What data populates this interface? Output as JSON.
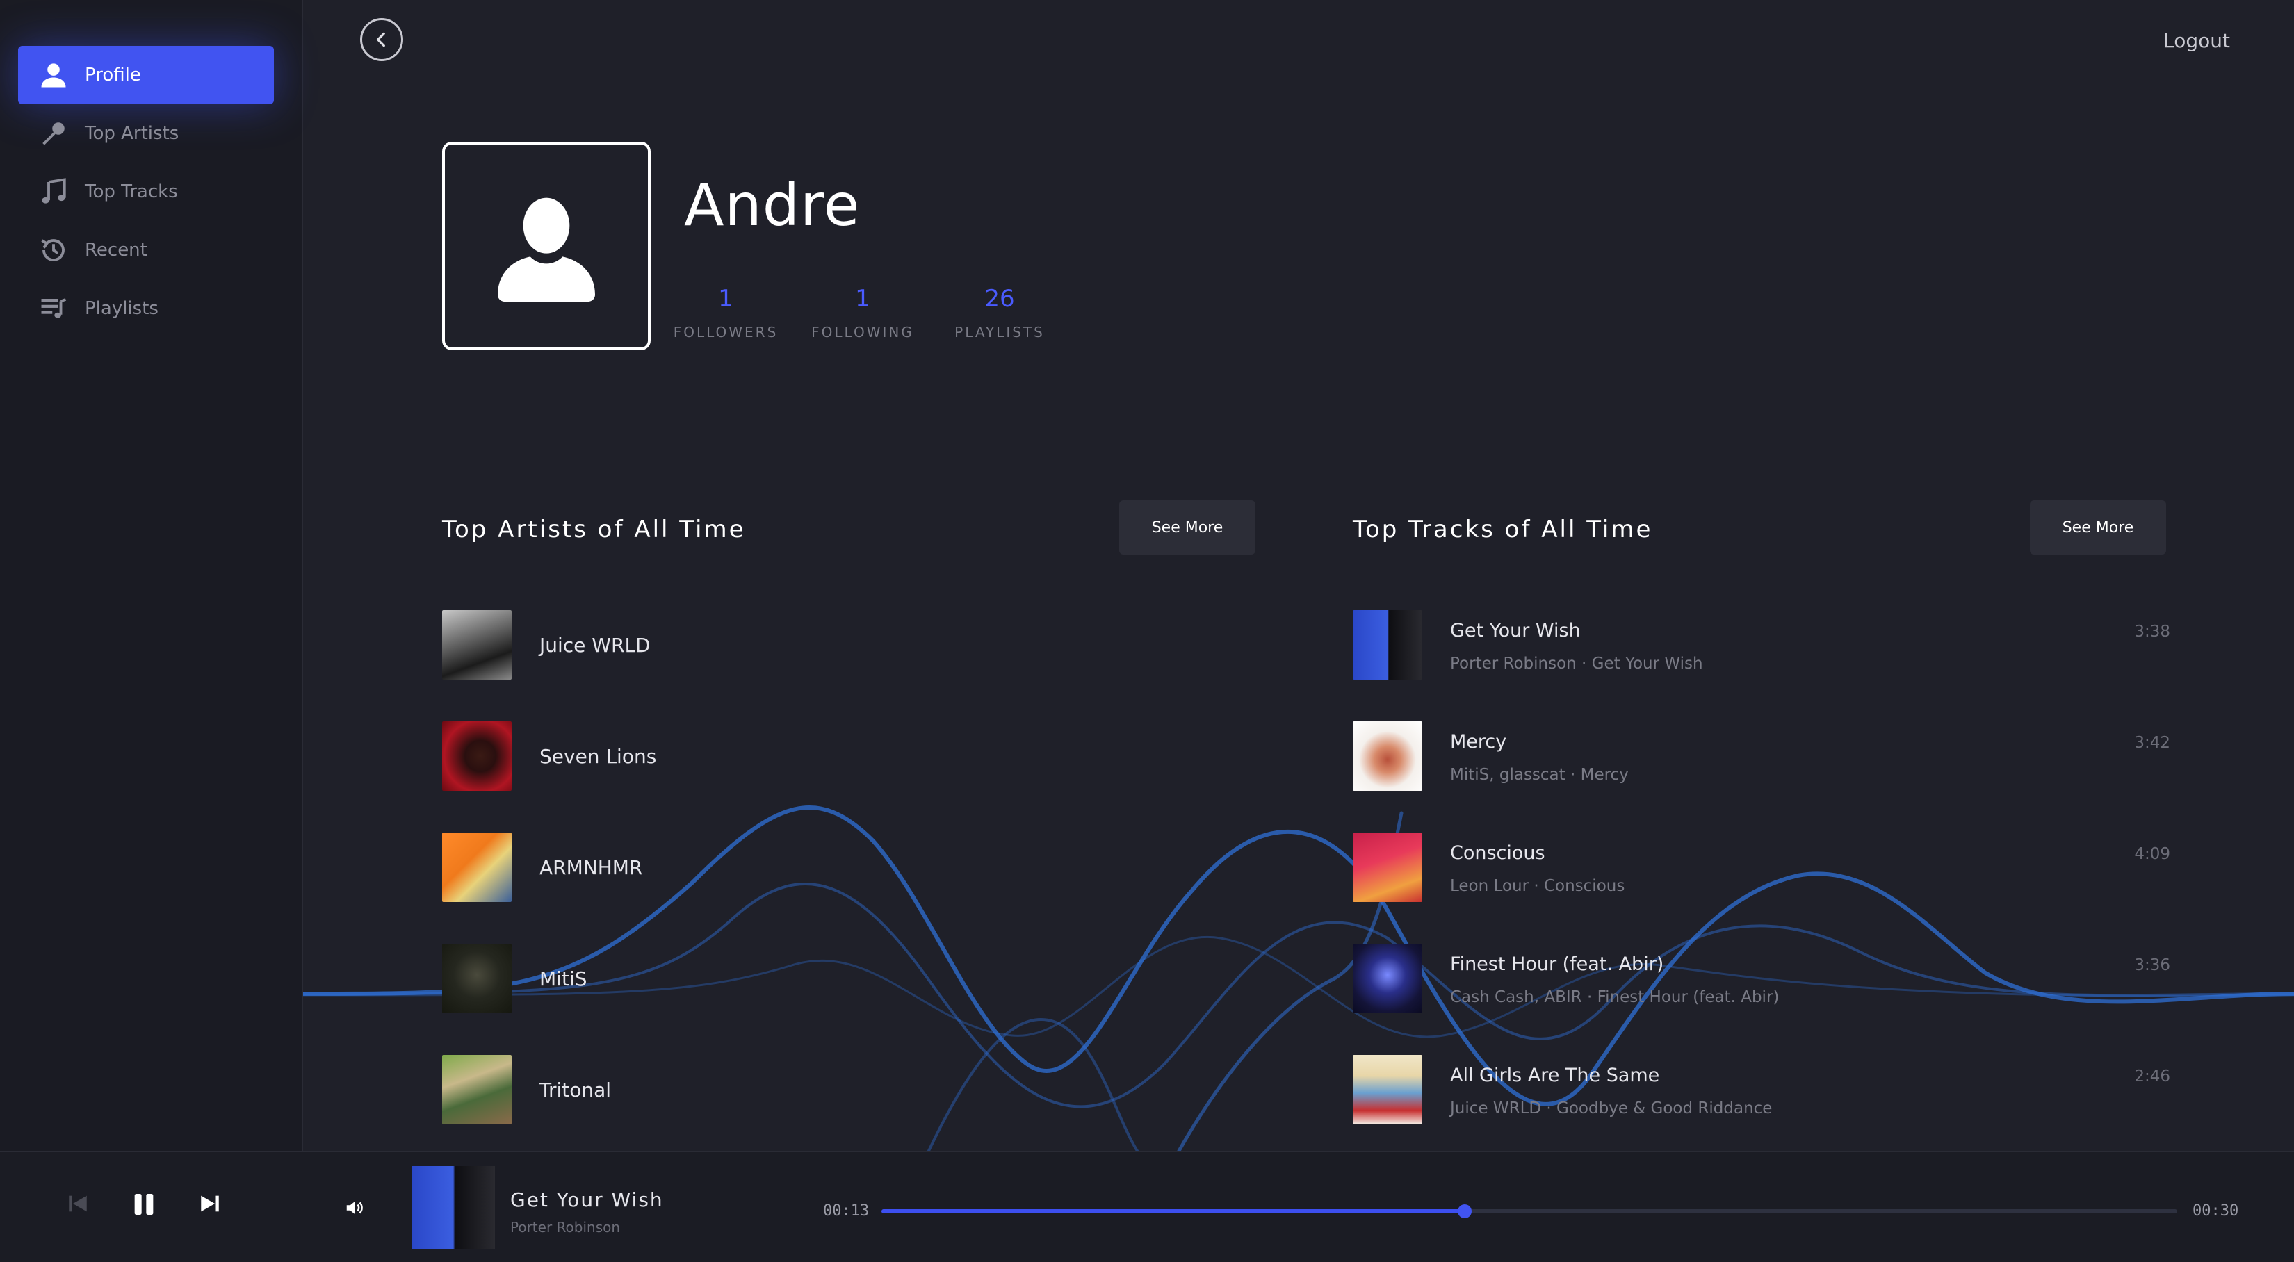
{
  "sidebar": {
    "items": [
      {
        "label": "Profile",
        "icon": "user-icon",
        "active": true
      },
      {
        "label": "Top Artists",
        "icon": "microphone-icon"
      },
      {
        "label": "Top Tracks",
        "icon": "music-note-icon"
      },
      {
        "label": "Recent",
        "icon": "history-icon"
      },
      {
        "label": "Playlists",
        "icon": "playlist-icon"
      }
    ]
  },
  "header": {
    "logout_label": "Logout"
  },
  "profile": {
    "name": "Andre",
    "stats": [
      {
        "value": "1",
        "label": "FOLLOWERS"
      },
      {
        "value": "1",
        "label": "FOLLOWING"
      },
      {
        "value": "26",
        "label": "PLAYLISTS"
      }
    ]
  },
  "top_artists": {
    "title": "Top Artists of All Time",
    "see_more": "See More",
    "items": [
      {
        "name": "Juice WRLD"
      },
      {
        "name": "Seven Lions"
      },
      {
        "name": "ARMNHMR"
      },
      {
        "name": "MitiS"
      },
      {
        "name": "Tritonal"
      }
    ]
  },
  "top_tracks": {
    "title": "Top Tracks of All Time",
    "see_more": "See More",
    "items": [
      {
        "title": "Get Your Wish",
        "subtitle": "Porter Robinson  ·  Get Your Wish",
        "duration": "3:38"
      },
      {
        "title": "Mercy",
        "subtitle": "MitiS, glasscat  ·  Mercy",
        "duration": "3:42"
      },
      {
        "title": "Conscious",
        "subtitle": "Leon Lour  ·  Conscious",
        "duration": "4:09"
      },
      {
        "title": "Finest Hour (feat. Abir)",
        "subtitle": "Cash Cash, ABIR  ·  Finest Hour (feat. Abir)",
        "duration": "3:36"
      },
      {
        "title": "All Girls Are The Same",
        "subtitle": "Juice WRLD  ·  Goodbye & Good Riddance",
        "duration": "2:46"
      }
    ]
  },
  "player": {
    "title": "Get Your Wish",
    "artist": "Porter Robinson",
    "elapsed": "00:13",
    "total": "00:30",
    "progress": 0.45
  },
  "colors": {
    "accent": "#4154f1",
    "background": "#1f2029",
    "wave": "#2f6fd6"
  }
}
